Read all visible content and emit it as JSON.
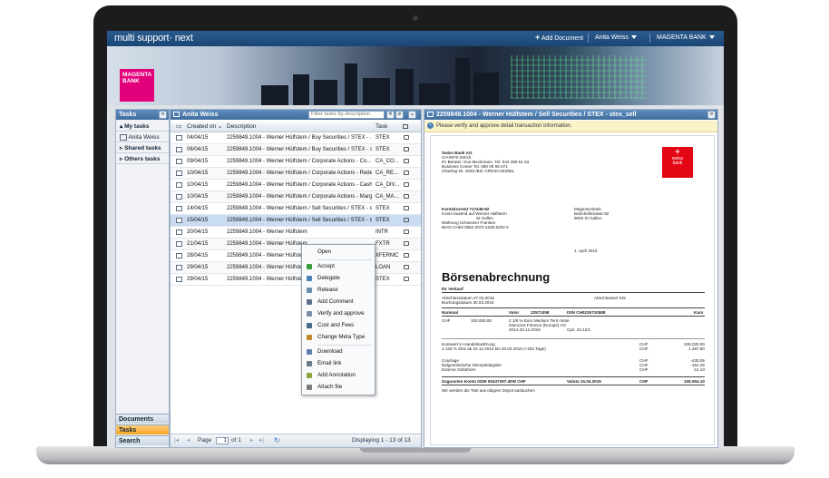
{
  "app": {
    "title": "multi support· next",
    "brand": "MAGENTA BANK"
  },
  "topbar": {
    "add_document": "Add Document",
    "user": "Anita Weiss",
    "bank": "MAGENTA BANK"
  },
  "banner": {
    "logo_line1": "MAGENTA",
    "logo_line2": "BANK"
  },
  "left": {
    "title": "Tasks",
    "items": [
      "My tasks",
      "Anita Weiss",
      "Shared tasks",
      "Others tasks"
    ],
    "bottom": [
      "Documents",
      "Tasks",
      "Search"
    ]
  },
  "mid": {
    "owner": "Anita Weiss",
    "filter_placeholder": "Filter tasks by description",
    "columns": [
      "Created on",
      "Description",
      "Task"
    ],
    "rows": [
      [
        "04/04/15",
        "2259849.1004 - Werner Hülfstem / Buy Securities / STEX - ...",
        "STEX"
      ],
      [
        "06/04/15",
        "2259849.1004 - Werner Hülfstem / Buy Securities / STEX - s...",
        "STEX"
      ],
      [
        "09/04/15",
        "2259849.1004 - Werner Hülfstem / Corporate Actions - Co...",
        "CA_CO..."
      ],
      [
        "10/04/15",
        "2259849.1004 - Werner Hülfstem / Corporate Actions - Rede...",
        "CA_RE..."
      ],
      [
        "10/04/15",
        "2259849.1004 - Werner Hülfstem / Corporate Actions - Cash...",
        "CA_DIV..."
      ],
      [
        "10/04/15",
        "2259849.1004 - Werner Hülfstem / Corporate Actions - Margi...",
        "CA_MA..."
      ],
      [
        "14/04/15",
        "2259849.1004 - Werner Hülfstem / Sell Securities / STEX - s...",
        "STEX"
      ],
      [
        "15/04/15",
        "2259849.1004 - Werner Hülfstem / Sell Securities / STEX - s...",
        "STEX"
      ],
      [
        "20/04/15",
        "2259849.1004 - Werner Hülfstem",
        "INTR"
      ],
      [
        "21/04/15",
        "2259849.1004 - Werner Hülfstem",
        "FXTR"
      ],
      [
        "28/04/15",
        "2259849.1004 - Werner Hülfstem",
        "XFERMC"
      ],
      [
        "29/04/15",
        "2259849.1004 - Werner Hülfstem",
        "LOAN"
      ],
      [
        "29/04/15",
        "2259849.1004 - Werner Hülfstem",
        "STEX"
      ]
    ],
    "pager": {
      "page_label": "Page",
      "page_value": "1",
      "of_label": "of 1",
      "displaying": "Displaying 1 - 13 of 13"
    }
  },
  "context_menu": {
    "items": [
      "Open",
      "Accept",
      "Delegate",
      "Release",
      "Add Comment",
      "Verify and approve",
      "Cost and Fees",
      "Change Meta Type",
      "Download",
      "Email link",
      "Add Annotation",
      "Attach file"
    ]
  },
  "right": {
    "title": "2259849.1004 - Werner Hülfstem / Sell Securities / STEX - stex_sell",
    "notice": "Please verify and approve detail transaction information.",
    "doc": {
      "sender": [
        "Swiss Bank AG",
        "CH-8070 Zürich",
        "Ihr Berater: Eva Meckmann, Tel. 044 299 51 63",
        "Business Center Tel. 080 06 96 071",
        "Clearing-Nr. 4845 /BIC CRESCHZZ55L"
      ],
      "swiss_logo": [
        "swiss",
        "bank"
      ],
      "account_label": "Kontokorrent  717448-82",
      "account_lines": [
        "Konto lautend auf   Werner Hülfstem",
        "St Gallen",
        "Währung              Schweizer Franken",
        "IBAN                   CH63 0552 6072 6228 5200 0"
      ],
      "recipient": [
        "Magenta Bank",
        "Bahnhofstrasse 82",
        "9000 St Gallen"
      ],
      "date": "1. April 2015",
      "heading": "Börsenabrechnung",
      "sub": "Ihr Verkauf",
      "abschluss": "Abschlussdatum      27.03.2015",
      "buchung": "Buchungsdatum       30.03.2015",
      "abschlussort": "Abschlussort SIX",
      "nominal_head": [
        "Nominal",
        "Valor",
        "22571058",
        "ISIN CH0225710588",
        "Kurs"
      ],
      "line1": [
        "CHF",
        "100.000.00",
        "2 1/8 % Euro Medium Term Note",
        "Glencore Finance (Europe) AG",
        "2014-23.12.2019",
        "Cps. 23.12/1"
      ],
      "kurswert": "Kurswert in Handelswährung",
      "zins": "2.125 % Zins ab 23.12.2014 bis 30.03.2015 (+252 Tage)",
      "fees": [
        "Courtage",
        "Eidgenössische Stempelabgabe",
        "Externe Gebühren"
      ],
      "ccy": [
        "CHF",
        "CHF",
        "CHF",
        "CHF",
        "CHF"
      ],
      "amounts": [
        "106.020.00",
        "1.487.50",
        "-430.05",
        "-161.25",
        "-12.10"
      ],
      "total_label": "Zugunsten Konto 0206 00437297.40W CHF",
      "valuta": "Valuta 15.04.2015",
      "total_ccy": "CHF",
      "total": "106.904.10",
      "footer": "Wir werden die Titel aus obigem Depot ausbuchen"
    }
  },
  "colors": {
    "accent": "#2a5b8e",
    "magenta": "#e2007a",
    "swiss_red": "#e30613",
    "selected_row": "#c9dcf2"
  }
}
